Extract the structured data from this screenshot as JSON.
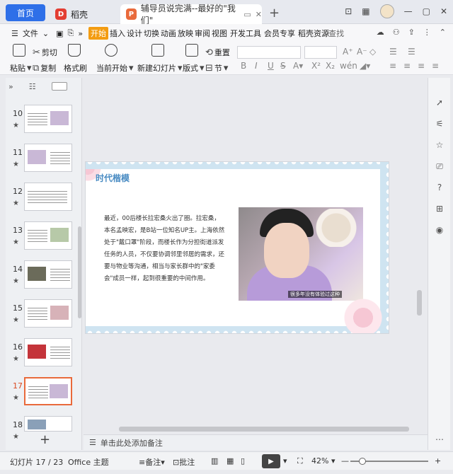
{
  "tabs": {
    "home": "首页",
    "daoke": "稻壳",
    "doc": "辅导员说完满--最好的\"我们\""
  },
  "window": {
    "badge_icon": "1-badge-icon",
    "grid_icon": "grid-icon",
    "minimize_icon": "minimize-icon",
    "maximize_icon": "maximize-icon",
    "close_icon": "close-icon"
  },
  "menu": {
    "file": "文件",
    "start": "开始",
    "items": [
      "插入",
      "设计",
      "切换",
      "动画",
      "放映",
      "审阅",
      "视图",
      "开发工具",
      "会员专享",
      "稻壳资源"
    ],
    "search": "查找"
  },
  "ribbon": {
    "paste": "粘贴",
    "cut": "剪切",
    "copy": "复制",
    "format_painter": "格式刷",
    "from_current": "当前开始",
    "new_slide": "新建幻灯片",
    "layout": "版式",
    "reset": "重置",
    "section": "节"
  },
  "slides": [
    {
      "num": "10",
      "star": "★"
    },
    {
      "num": "11",
      "star": "★"
    },
    {
      "num": "12",
      "star": "★"
    },
    {
      "num": "13",
      "star": "★"
    },
    {
      "num": "14",
      "star": "★"
    },
    {
      "num": "15",
      "star": "★"
    },
    {
      "num": "16",
      "star": "★"
    },
    {
      "num": "17",
      "star": "★"
    },
    {
      "num": "18",
      "star": "★"
    }
  ],
  "slide": {
    "title": "时代楷模",
    "body": "最近，00后楼长拉宏桑火出了圈。拉宏桑，本名孟映宏，是B站一位知名UP主。上海依然处于\"戴口罩\"阶段，而楼长作为分担街道派发任务的人员，不仅要协调邻里邻居的需求，还要与物业等沟通，相当与家长群中的\"家委会\"成员一样，起到很重要的中间作用。",
    "caption": "很多年没有体验过这种"
  },
  "notes": "单击此处添加备注",
  "status": {
    "slide_count": "幻灯片 17 / 23",
    "theme": "Office 主题",
    "notes_btn": "备注",
    "comment_btn": "批注",
    "zoom": "42%"
  },
  "colors": {
    "home_tab": "#2e6fe8",
    "start_tab": "#f39c12",
    "active_thumb": "#e96a3b",
    "slide_title": "#4a8cc3"
  }
}
